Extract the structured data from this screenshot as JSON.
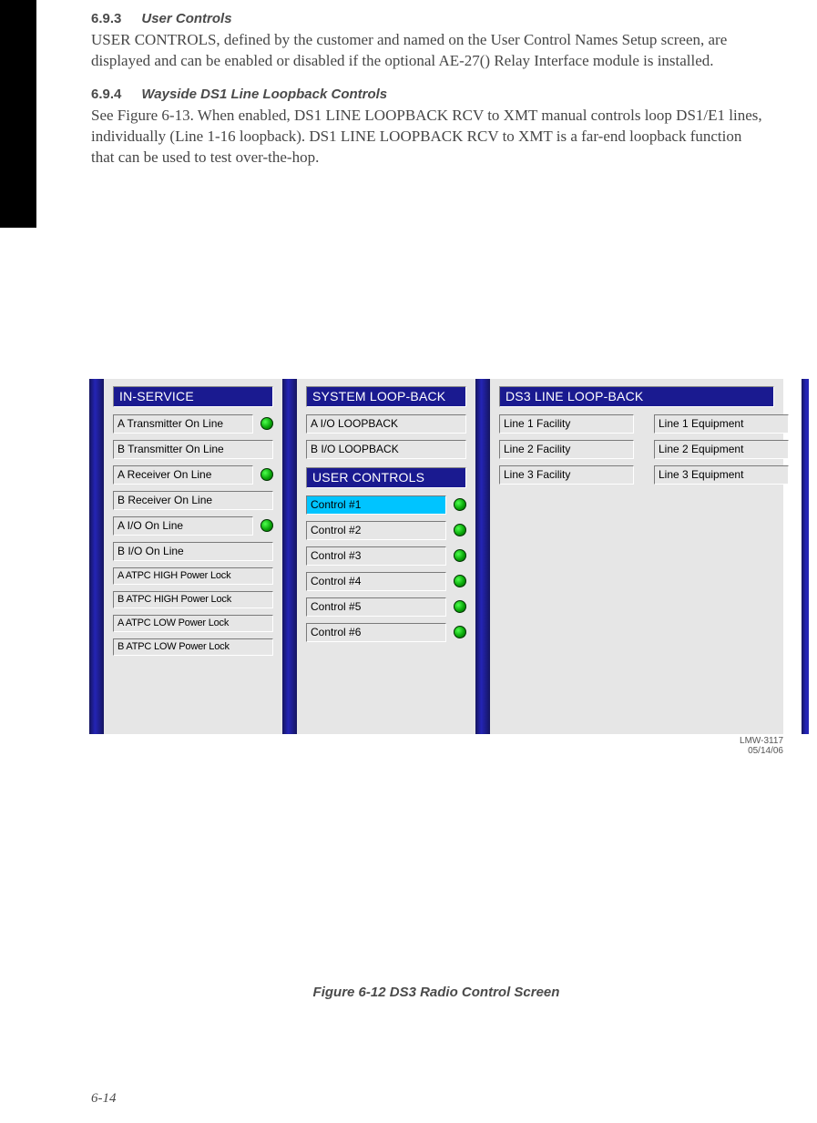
{
  "section1": {
    "num": "6.9.3",
    "title": "User Controls",
    "para": "USER CONTROLS, defined by the customer and named on the User Control Names Setup screen, are displayed and can be enabled or disabled if the optional AE-27() Relay Interface module is installed."
  },
  "section2": {
    "num": "6.9.4",
    "title": "Wayside DS1 Line Loopback Controls",
    "para": "See Figure 6-13. When enabled, DS1 LINE LOOPBACK RCV to XMT manual controls loop DS1/E1 lines, individually (Line 1-16 loopback). DS1 LINE LOOPBACK RCV to XMT is a far-end loopback function that can be used to test over-the-hop."
  },
  "ui": {
    "inservice_header": "IN-SERVICE",
    "inservice_items": [
      {
        "label": "A Transmitter On Line",
        "led": true
      },
      {
        "label": "B Transmitter On Line",
        "led": false
      },
      {
        "label": "A Receiver On Line",
        "led": true
      },
      {
        "label": "B Receiver On Line",
        "led": false
      },
      {
        "label": "A I/O On Line",
        "led": true
      },
      {
        "label": "B I/O On Line",
        "led": false
      },
      {
        "label": "A ATPC HIGH Power Lock",
        "led": false,
        "small": true
      },
      {
        "label": "B ATPC HIGH Power Lock",
        "led": false,
        "small": true
      },
      {
        "label": "A ATPC LOW Power Lock",
        "led": false,
        "small": true
      },
      {
        "label": "B ATPC LOW Power Lock",
        "led": false,
        "small": true
      }
    ],
    "sysloop_header": "SYSTEM LOOP-BACK",
    "sysloop_items": [
      {
        "label": "A I/O LOOPBACK"
      },
      {
        "label": "B I/O LOOPBACK"
      }
    ],
    "userctrl_header": "USER CONTROLS",
    "userctrl_items": [
      {
        "label": "Control #1",
        "led": true,
        "selected": true
      },
      {
        "label": "Control #2",
        "led": true
      },
      {
        "label": "Control #3",
        "led": true
      },
      {
        "label": "Control #4",
        "led": true
      },
      {
        "label": "Control #5",
        "led": true
      },
      {
        "label": "Control #6",
        "led": true
      }
    ],
    "ds3_header": "DS3 LINE LOOP-BACK",
    "ds3_facility": [
      "Line 1 Facility",
      "Line 2 Facility",
      "Line 3 Facility"
    ],
    "ds3_equipment": [
      "Line 1 Equipment",
      "Line 2 Equipment",
      "Line 3 Equipment"
    ],
    "meta_id": "LMW-3117",
    "meta_date": "05/14/06"
  },
  "figure_caption": "Figure 6-12  DS3 Radio Control Screen",
  "page_number": "6-14"
}
